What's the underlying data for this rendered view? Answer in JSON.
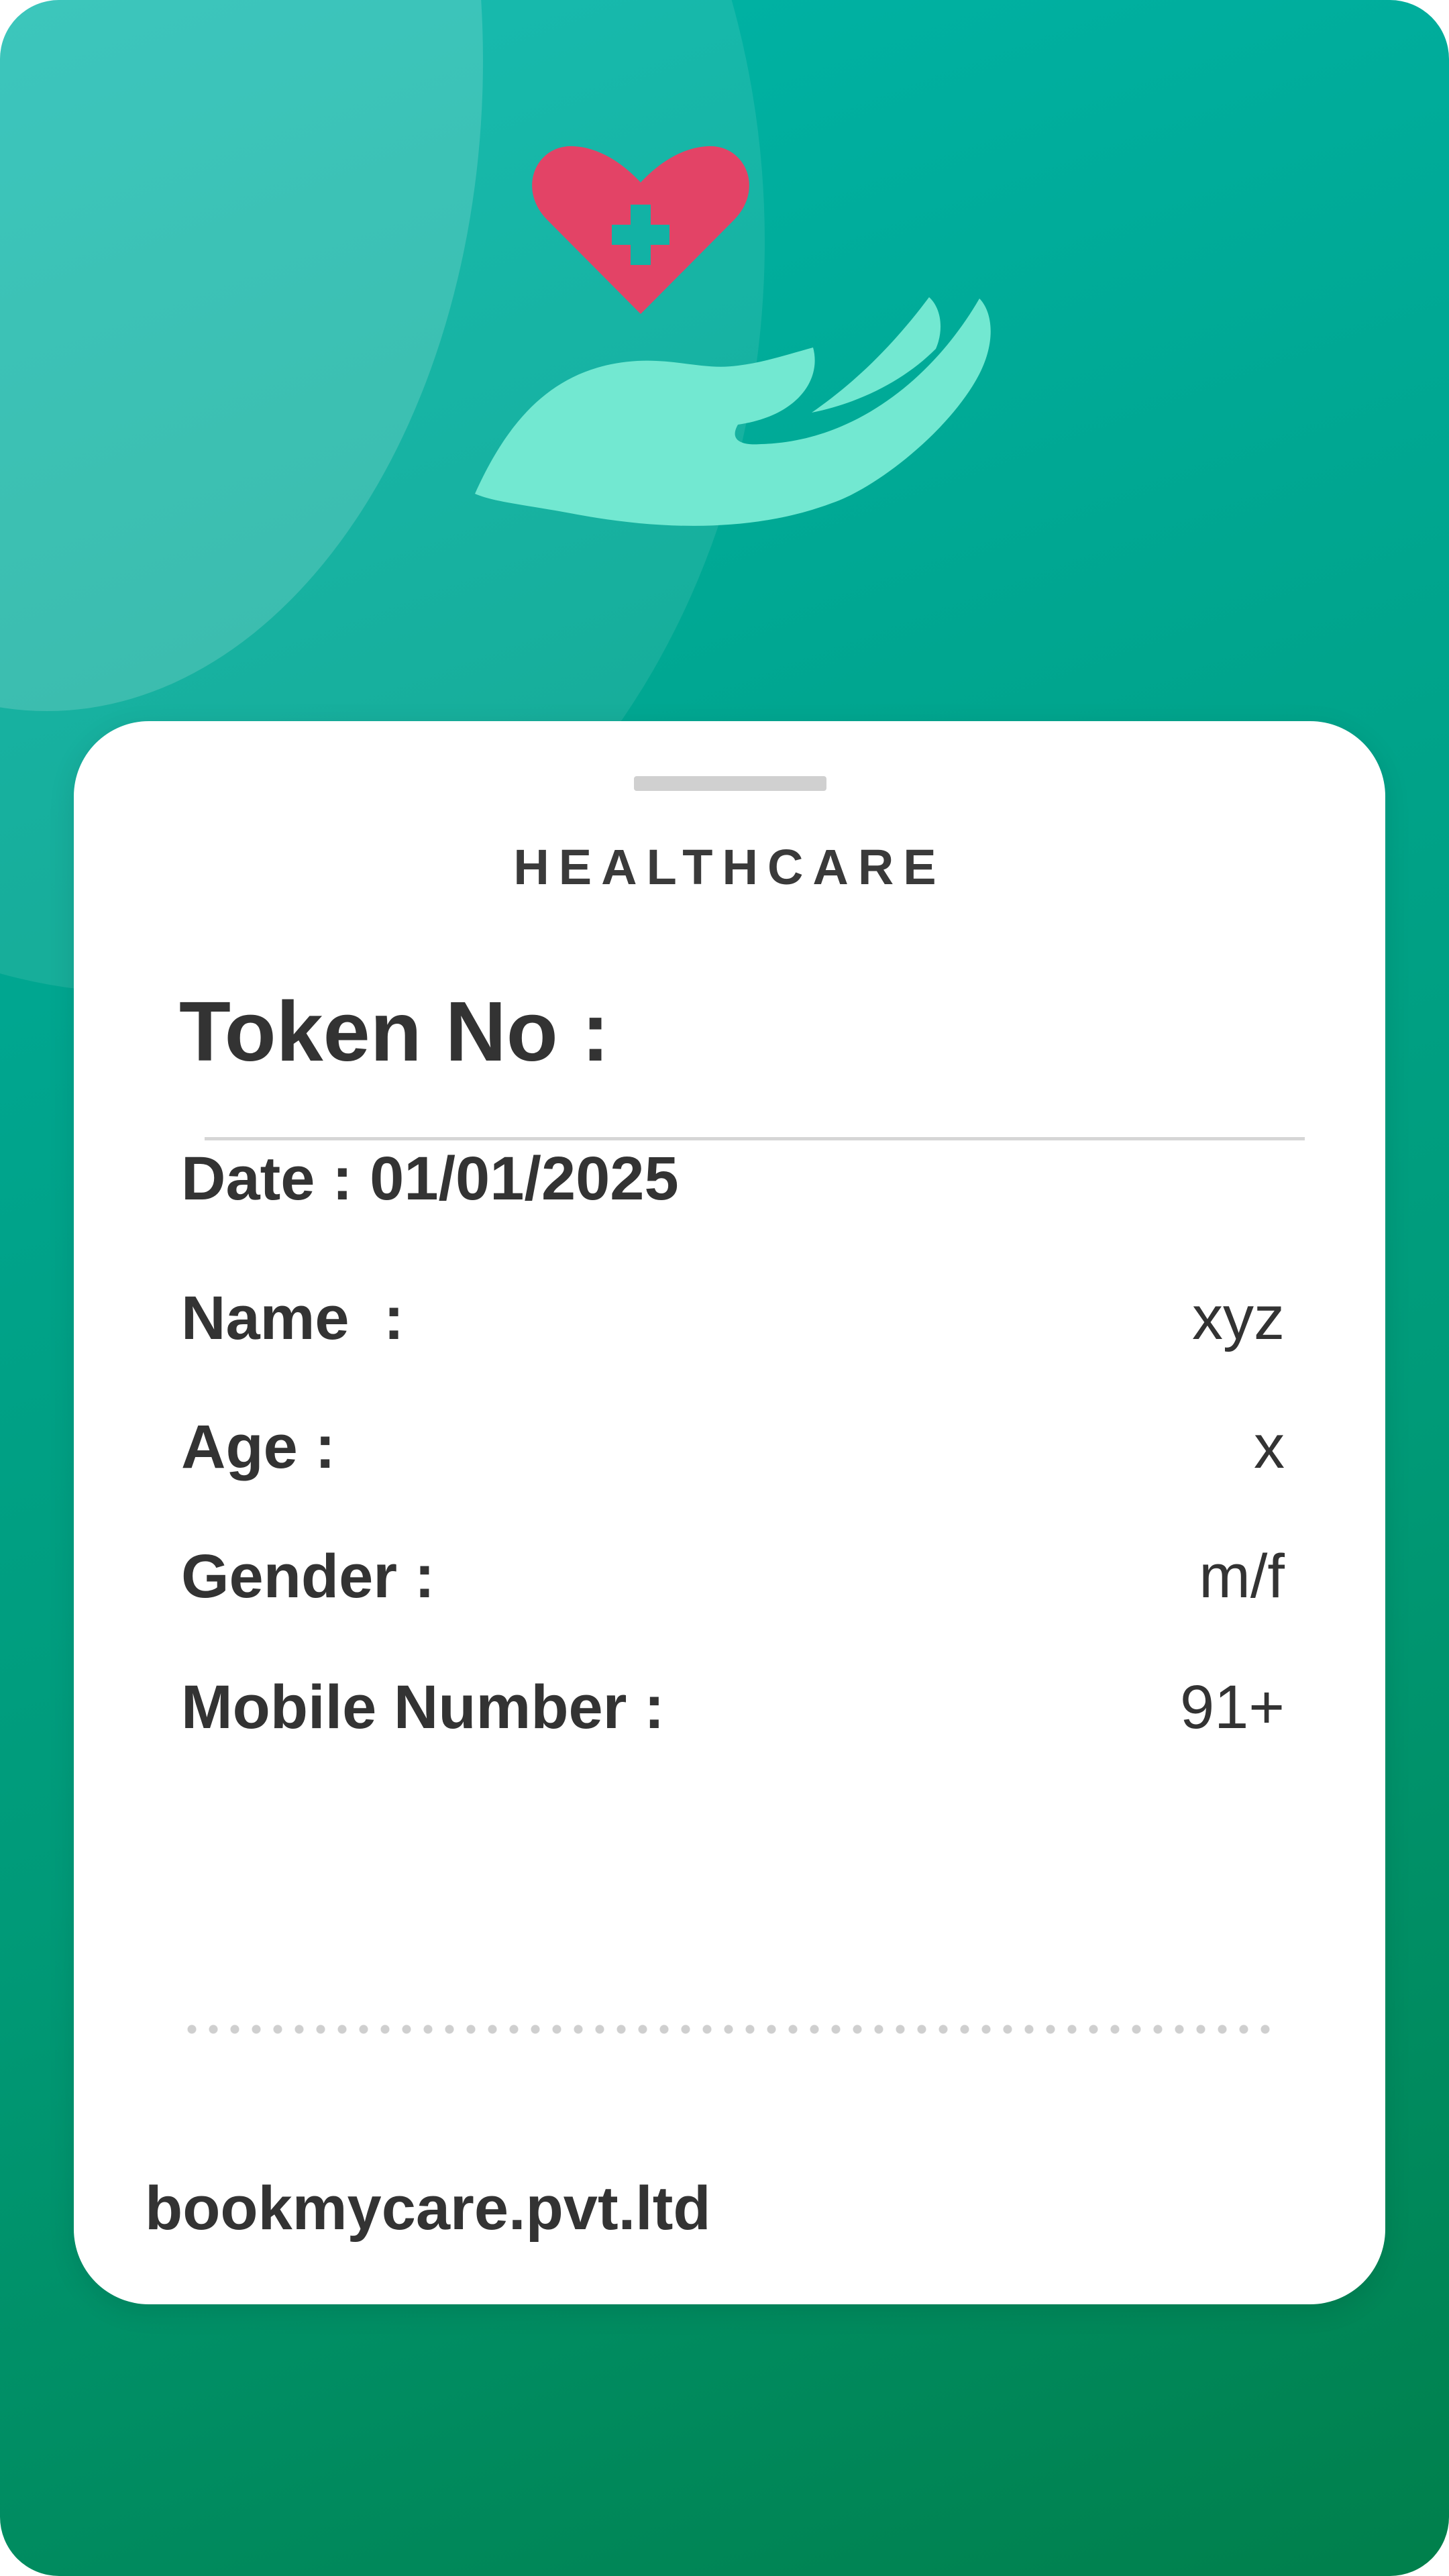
{
  "colors": {
    "background_top": "#00b5a9",
    "background_bottom": "#007f4b",
    "heart": "#e34366",
    "hand": "#72e8d1",
    "cross": "#12b2a5",
    "card": "#ffffff",
    "text": "#333333"
  },
  "logo": {
    "icons": [
      "heart-with-cross-icon",
      "open-hand-icon"
    ]
  },
  "card": {
    "brand": "HEALTHCARE",
    "token_label": "Token No :",
    "date": "Date : 01/01/2025",
    "fields": [
      {
        "label": "Name  :",
        "value": "xyz"
      },
      {
        "label": "Age :",
        "value": "x"
      },
      {
        "label": "Gender :",
        "value": "m/f"
      },
      {
        "label": "Mobile Number :",
        "value": "91+"
      }
    ],
    "footer": "bookmycare.pvt.ltd"
  }
}
